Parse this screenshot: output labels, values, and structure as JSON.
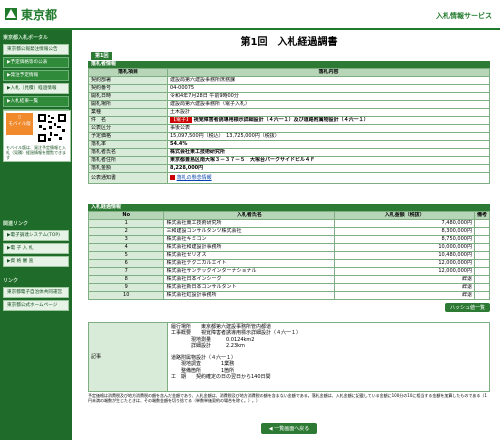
{
  "header": {
    "logo": "東京都",
    "service": "入札情報サービス"
  },
  "sidebar": {
    "section_main": "東京都入札ポータル",
    "items": [
      "東京都公報発注情報公告",
      "▶予定価格等の公表",
      "▶発注予定情報",
      "▶入札（見積）経過情報",
      "▶入札結果一覧",
      "▶参加入札参加業者名簿",
      "▶入札参加資格情報"
    ],
    "mobile_label": "モバイル版",
    "mobile_note": "モバイル版は、発注予定情報と入札（見積）経過情報を閲覧できます",
    "section_related": "関連リンク",
    "related": [
      "▶電子調達システム(TOP)",
      "▶電 子 入 札",
      "▶資 格 審 査"
    ],
    "section_links": "リンク",
    "links": [
      "東京都電子自治体共同運営",
      "東京都公式ホームページ"
    ]
  },
  "page": {
    "title": "第1回　入札経過調書",
    "round_tab": "第1回"
  },
  "info": {
    "section": "落札者情報",
    "col_item": "落札項目",
    "col_content": "落札内容",
    "rows": [
      {
        "label": "契約部署",
        "value": "建設局第六建設事務所庶務課"
      },
      {
        "label": "契約番号",
        "value": "04-00075"
      },
      {
        "label": "開札日時",
        "value": "令和4年7月28日 午前9時00分"
      },
      {
        "label": "開札場所",
        "value": "建設局第六建設事務所（電子入札）"
      },
      {
        "label": "業種",
        "value": "土木設計"
      },
      {
        "label": "件　名",
        "value": "視覚障害者誘導用標示詳細設計（４六一１）及び道路附属物設計（４六一１）",
        "tag": "【電子】"
      },
      {
        "label": "公表区分",
        "value": "事後公表"
      },
      {
        "label": "予定価格",
        "value": "15,097,500円（税込）　13,725,000円（税抜）"
      },
      {
        "label": "落札率",
        "value": "54.4%"
      },
      {
        "label": "落札者氏名",
        "value": "株式会社東工技術研究所"
      },
      {
        "label": "落札者住所",
        "value": "東京都豊島区南大塚３－３７－５　大塚台パークサイドビル４Ｆ"
      },
      {
        "label": "落札金額",
        "value": "8,228,000円"
      },
      {
        "label": "公表通知書",
        "value": "落札の懸念情報"
      }
    ]
  },
  "bidders": {
    "section": "入札経過情報",
    "col_no": "No",
    "col_name": "入札者氏名",
    "col_amount": "入札金額（税抜）",
    "col_note": "備考",
    "rows": [
      {
        "no": "1",
        "name": "株式会社東工技術研究所",
        "amount": "7,480,000円"
      },
      {
        "no": "2",
        "name": "三和建設コンサルタンツ株式会社",
        "amount": "8,300,000円"
      },
      {
        "no": "3",
        "name": "株式会社キミコン",
        "amount": "8,750,000円"
      },
      {
        "no": "4",
        "name": "株式会社和建設計事務所",
        "amount": "10,000,000円"
      },
      {
        "no": "5",
        "name": "株式会社セリオス",
        "amount": "10,480,000円"
      },
      {
        "no": "6",
        "name": "株式会社テクニカルエイト",
        "amount": "12,000,000円"
      },
      {
        "no": "7",
        "name": "株式会社サンテックインターナショナル",
        "amount": "12,000,000円"
      },
      {
        "no": "8",
        "name": "株式会社日本インシーク",
        "amount": "辞退"
      },
      {
        "no": "9",
        "name": "株式会社新日本コンサルタント",
        "amount": "辞退"
      },
      {
        "no": "10",
        "name": "株式会社虹設計事務所",
        "amount": "辞退"
      }
    ],
    "history_btn": "ハッシュ値一覧"
  },
  "notes": {
    "label": "記事",
    "lines": [
      "履行場所　　東京都第六建設事務所管内都道",
      "工事概要　　視覚障害者誘導用標示詳細設計（４六一１）",
      "　　　　現地測量　　　0.0124km2",
      "　　　　詳細設計　　　2.23km",
      "",
      "道路附属物設計（４六一１）",
      "　　現地調査　　　　1業務",
      "　　整備箇所　　　　1箇所",
      "工　期　　契約確定の日の翌日から140日間"
    ]
  },
  "footnote": "予定価格は消費税及び地方消費税の額を含んだ金額であり、入札金額は、消費税及び地方消費税の額を含まない金額である。落札金額は、入札金額に記載している金額に100分の10に相当する金額を加算したものである（1円未満の端数が生じたときは、その端数金額を切り捨てる（単数単価契約の場合を除く。）。）",
  "back_btn": "◀ 一覧画面へ戻る"
}
